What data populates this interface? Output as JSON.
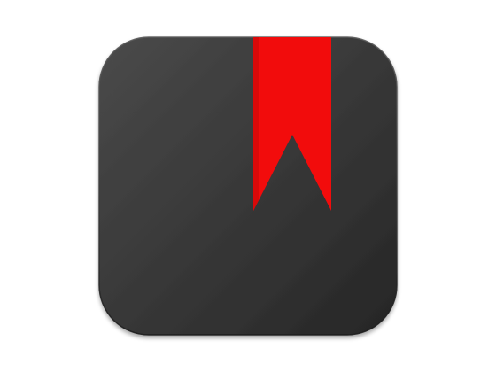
{
  "icon": {
    "name": "bookmark-app-icon",
    "symbol": "bookmark-ribbon",
    "colors": {
      "background": "#ffffff",
      "tile_light": "#4a4a4a",
      "tile_dark": "#262626",
      "tile_highlight": "#5a5a5a",
      "ribbon": "#f20c0c",
      "ribbon_shade": "#c90808"
    }
  }
}
